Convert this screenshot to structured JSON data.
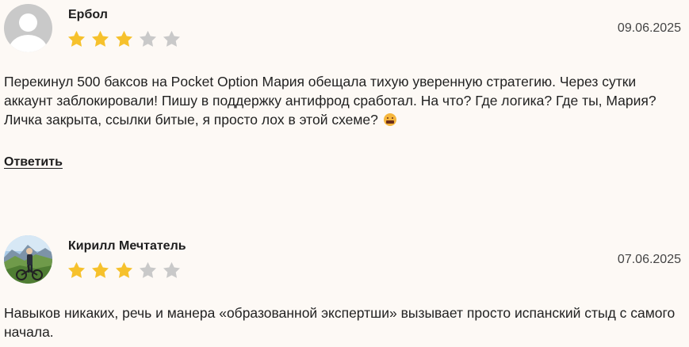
{
  "reviews": [
    {
      "author": "Ербол",
      "date": "09.06.2025",
      "rating": 3,
      "max_rating": 5,
      "avatar": "default-user-icon",
      "text": "Перекинул 500 баксов на Pocket Option Мария обещала тихую уверенную стратегию. Через сутки аккаунт заблокировали! Пишу в поддержку антифрод сработал. На что? Где логика? Где ты, Мария? Личка закрыта, ссылки битые, я просто лох в этой схеме?",
      "emoji": "censored-swearing-face-icon",
      "reply_label": "Ответить"
    },
    {
      "author": "Кирилл Мечтатель",
      "date": "07.06.2025",
      "rating": 3,
      "max_rating": 5,
      "avatar": "user-photo-mountains-bike",
      "text": "Навыков никаких, речь и манера «образованной экспертши» вызывает просто испанский стыд с самого начала."
    }
  ],
  "colors": {
    "background": "#fdf9f5",
    "star_filled": "#f6c12c",
    "star_empty": "#c9c9c9",
    "avatar_default": "#c9c9c9"
  }
}
